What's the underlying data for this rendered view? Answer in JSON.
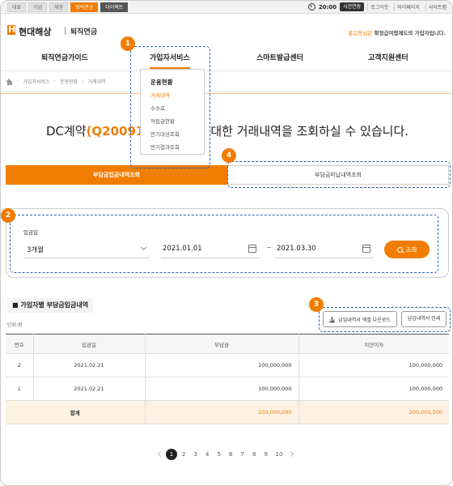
{
  "util": {
    "tabs": [
      "대표",
      "기업",
      "채용",
      "퇴직연금",
      "다이렉트"
    ],
    "time": "20:00",
    "extend": "시간연장",
    "links": [
      "로그아웃",
      "마이페이지",
      "사이트맵"
    ]
  },
  "header": {
    "logo": "현대해상",
    "sub": "퇴직연금",
    "greeting_name": "홍길동님은",
    "greeting_rest": " 확정급여형제도의 가입자입니다."
  },
  "gnb": [
    "퇴직연금가이드",
    "가입자서비스",
    "스마트발급센터",
    "고객지원센터"
  ],
  "dropdown": {
    "title": "운용현황",
    "items": [
      "거래내역",
      "수수료",
      "적립금현황",
      "만기대상조회",
      "만기결과조회"
    ]
  },
  "breadcrumb": [
    "가입자서비스",
    "운용현황",
    "거래내역"
  ],
  "headline": {
    "prefix": "DC계약",
    "code": "(Q20091",
    "suffix": "대한 거래내역을 조회하실 수 있습니다."
  },
  "tabs": {
    "active": "부담금입금내역조회",
    "inactive": "부담금미납내역조회"
  },
  "search": {
    "label": "입금일",
    "period": "3개월",
    "start": "2021.01.01",
    "tilde": "~",
    "end": "2021.03.30",
    "button": "조회"
  },
  "section": {
    "title": "■  가입자별 부담금입금내역",
    "unit": "단위:원",
    "download": "납입내역서 엑셀 다운로드",
    "print": "납입내역서 인쇄"
  },
  "table": {
    "headers": [
      "번호",
      "입금일",
      "부담금",
      "지연이자"
    ],
    "rows": [
      [
        "2",
        "2021.02.21",
        "100,000,000",
        "100,000,000"
      ],
      [
        "1",
        "2021.02.21",
        "100,000,000",
        "100,000,000"
      ]
    ],
    "total": [
      "합계",
      "200,000,000",
      "200,000,000"
    ]
  },
  "pager": [
    "1",
    "2",
    "3",
    "4",
    "5",
    "6",
    "7",
    "8",
    "9",
    "10"
  ],
  "annotations": [
    "1",
    "2",
    "3",
    "4"
  ],
  "colors": {
    "accent": "#f07d00",
    "annotation": "#2b5fb3"
  }
}
